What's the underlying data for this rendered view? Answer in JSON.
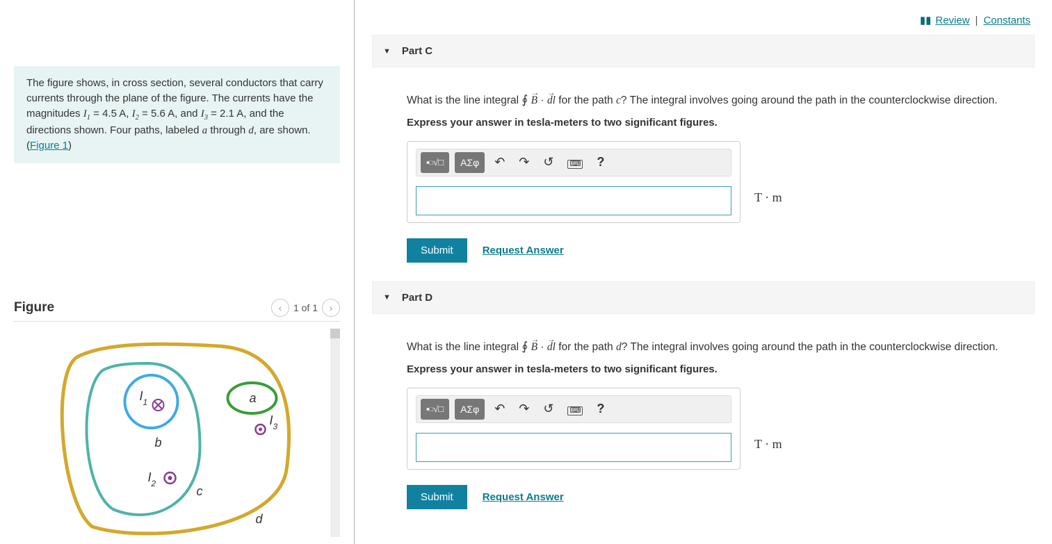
{
  "top_links": {
    "review": "Review",
    "constants": "Constants"
  },
  "problem": {
    "text_a": "The figure shows, in cross section, several conductors that carry currents through the plane of the figure. The currents have the magnitudes ",
    "I1_label": "I",
    "I1_sub": "1",
    "I1_eq": " = 4.5 A, ",
    "I2_label": "I",
    "I2_sub": "2",
    "I2_eq": " = 5.6 A, and ",
    "I3_label": "I",
    "I3_sub": "3",
    "I3_eq": " = 2.1 A, and the directions shown. Four paths, labeled ",
    "text_b": "a",
    "text_c": " through ",
    "text_d": "d",
    "text_e": ", are shown. (",
    "fig_link": "Figure 1",
    "text_f": ")"
  },
  "figure": {
    "title": "Figure",
    "pager": "1 of 1"
  },
  "parts": {
    "c": {
      "title": "Part C",
      "question_pre": "What is the line integral ",
      "question_post": " for the path ",
      "path_letter": "c",
      "question_tail": "? The integral involves going around the path in the counterclockwise direction.",
      "instruction": "Express your answer in tesla-meters to two significant figures.",
      "units": "T · m",
      "submit": "Submit",
      "request": "Request Answer"
    },
    "d": {
      "title": "Part D",
      "question_pre": "What is the line integral ",
      "question_post": " for the path ",
      "path_letter": "d",
      "question_tail": "? The integral involves going around the path in the counterclockwise direction.",
      "instruction": "Express your answer in tesla-meters to two significant figures.",
      "units": "T · m",
      "submit": "Submit",
      "request": "Request Answer"
    }
  },
  "toolbar": {
    "math": "√",
    "greek": "ΑΣφ",
    "undo": "↶",
    "redo": "↷",
    "reset": "↺",
    "help": "?"
  }
}
